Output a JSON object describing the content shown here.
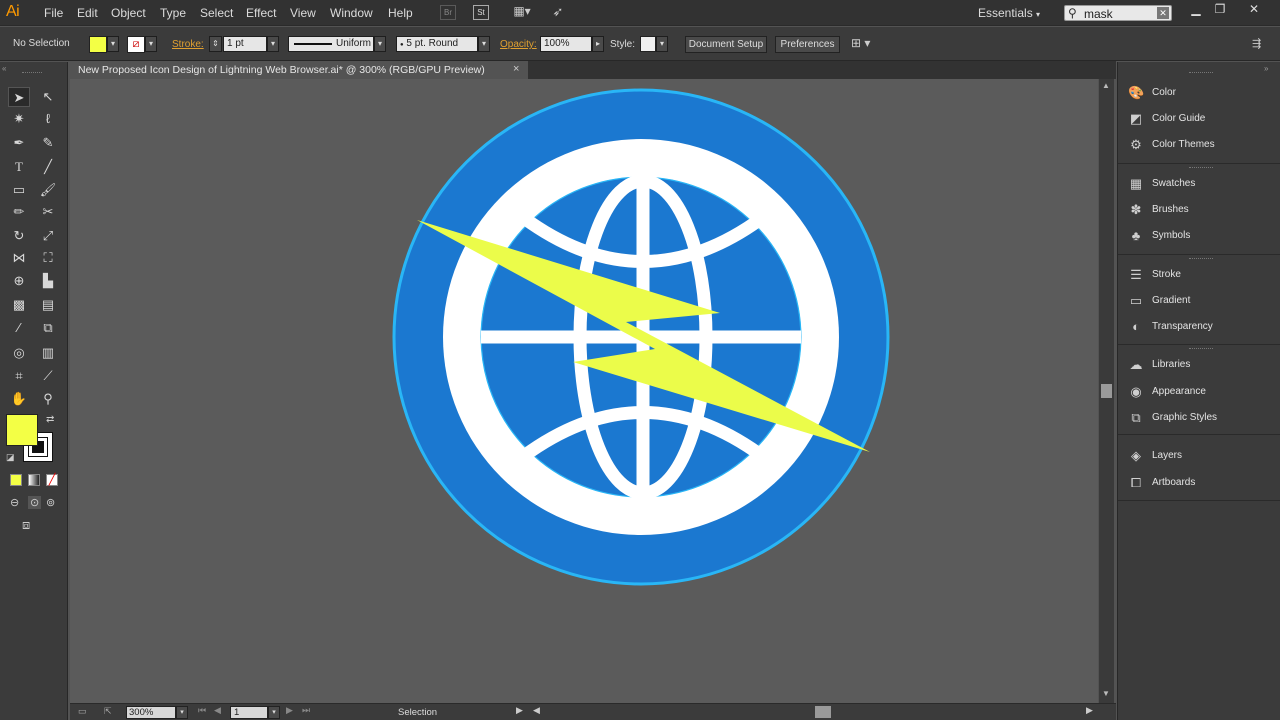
{
  "app": {
    "logo": "Ai"
  },
  "menu": [
    "File",
    "Edit",
    "Object",
    "Type",
    "Select",
    "Effect",
    "View",
    "Window",
    "Help"
  ],
  "menubar_icons": [
    "bridge-icon",
    "stock-icon",
    "arrange-documents-icon",
    "gpu-performance-icon"
  ],
  "workspace": "Essentials",
  "search": {
    "value": "mask"
  },
  "control_bar": {
    "selection_label": "No Selection",
    "stroke_label": "Stroke:",
    "stroke_weight": "1 pt",
    "stroke_profile": "Uniform",
    "brush": "5 pt. Round",
    "opacity_label": "Opacity:",
    "opacity_value": "100%",
    "style_label": "Style:",
    "document_setup": "Document Setup",
    "preferences": "Preferences"
  },
  "document": {
    "tab_title": "New Proposed Icon Design of Lightning Web Browser.ai* @ 300% (RGB/GPU Preview)",
    "close": "×"
  },
  "status_bar": {
    "zoom": "300%",
    "artboard": "1",
    "tool": "Selection"
  },
  "colors": {
    "fill": "#f3ff45",
    "circle_outer": "#1b78d0",
    "circle_edge": "#29b6f6",
    "ring": "#ffffff",
    "bolt": "#ebfc4a"
  },
  "panel_groups": [
    [
      {
        "label": "Color",
        "icon": "color-icon"
      },
      {
        "label": "Color Guide",
        "icon": "color-guide-icon"
      },
      {
        "label": "Color Themes",
        "icon": "color-themes-icon"
      }
    ],
    [
      {
        "label": "Swatches",
        "icon": "swatches-icon"
      },
      {
        "label": "Brushes",
        "icon": "brushes-icon"
      },
      {
        "label": "Symbols",
        "icon": "symbols-icon"
      }
    ],
    [
      {
        "label": "Stroke",
        "icon": "stroke-icon"
      },
      {
        "label": "Gradient",
        "icon": "gradient-icon"
      },
      {
        "label": "Transparency",
        "icon": "transparency-icon"
      }
    ],
    [
      {
        "label": "Libraries",
        "icon": "libraries-icon"
      },
      {
        "label": "Appearance",
        "icon": "appearance-icon"
      },
      {
        "label": "Graphic Styles",
        "icon": "graphic-styles-icon"
      }
    ],
    [
      {
        "label": "Layers",
        "icon": "layers-icon"
      },
      {
        "label": "Artboards",
        "icon": "artboards-icon"
      }
    ]
  ]
}
